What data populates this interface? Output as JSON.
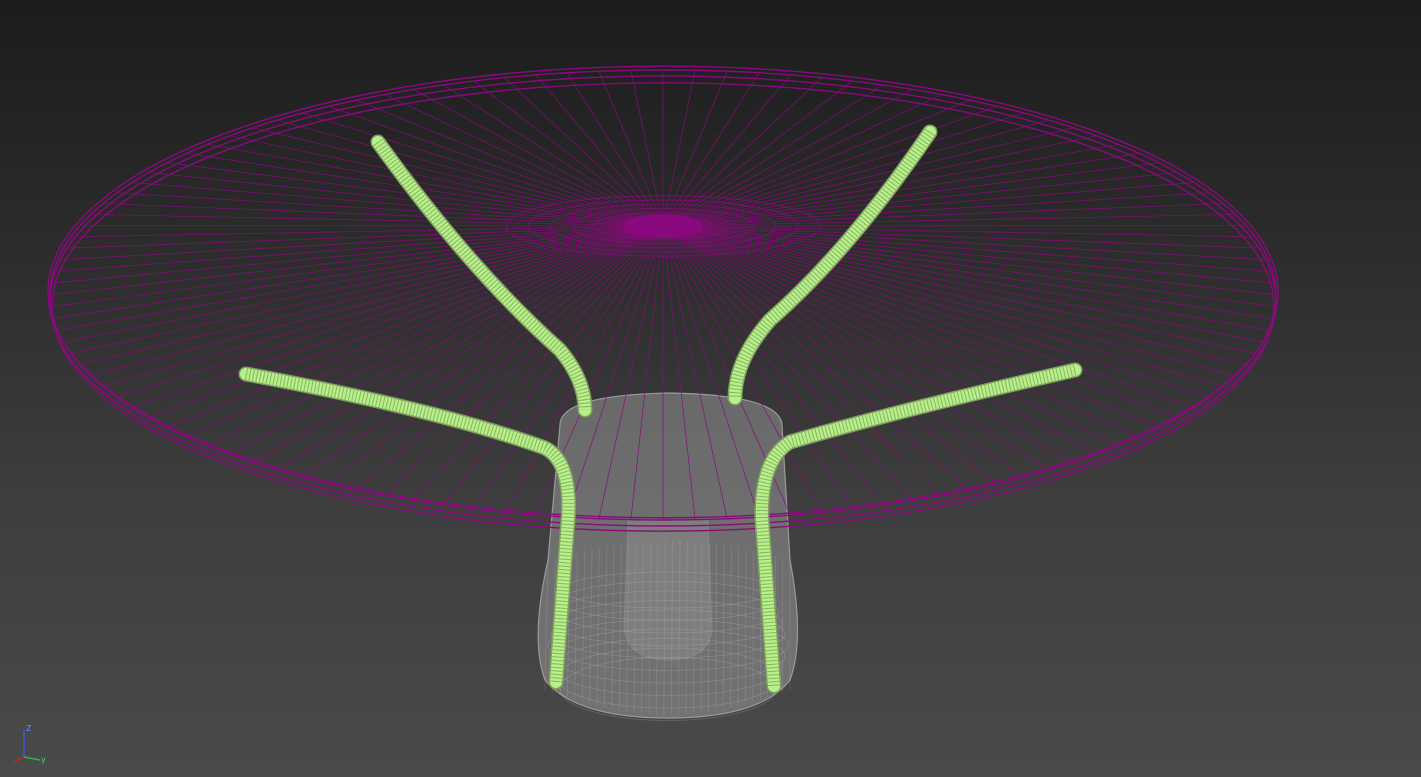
{
  "viewport": {
    "background_top": "#1c1c1c",
    "background_bottom": "#4a4a4a"
  },
  "model": {
    "tabletop_color": "#8a0a7e",
    "legs_color": "#b8f08a",
    "base_color": "#9a9a9a",
    "tabletop_spokes": 120,
    "leg_count": 4
  },
  "axis_gizmo": {
    "z_label": "Z",
    "y_label": "y",
    "x_color": "#d02020",
    "y_color": "#20c040",
    "z_color": "#3a5ad0"
  }
}
